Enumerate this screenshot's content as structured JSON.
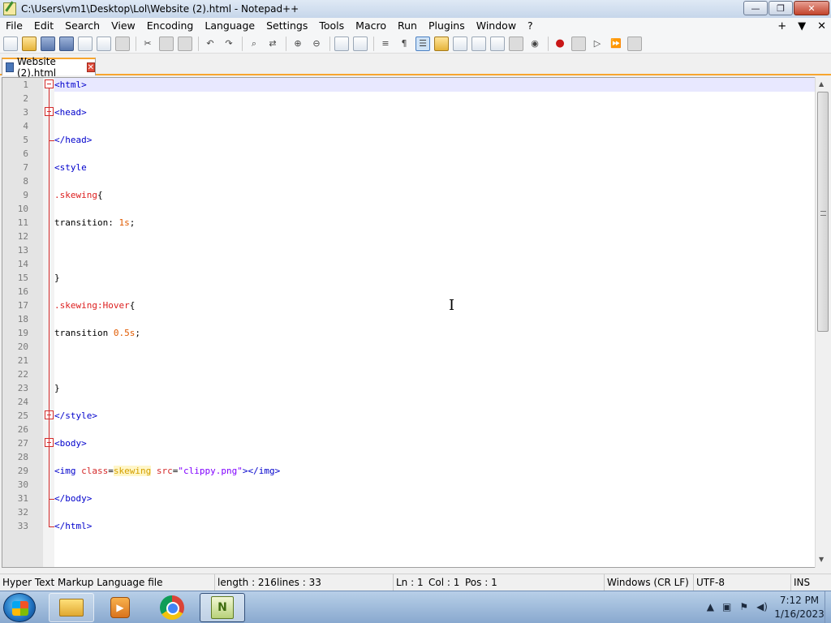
{
  "window": {
    "title": "C:\\Users\\vm1\\Desktop\\Lol\\Website (2).html - Notepad++",
    "controls": {
      "minimize": "—",
      "maximize": "❐",
      "close": "✕"
    }
  },
  "menu": {
    "items": [
      "File",
      "Edit",
      "Search",
      "View",
      "Encoding",
      "Language",
      "Settings",
      "Tools",
      "Macro",
      "Run",
      "Plugins",
      "Window",
      "?"
    ],
    "right": {
      "plus": "+",
      "down": "▼",
      "close": "✕"
    }
  },
  "toolbar": {
    "icons": [
      "new-file-icon",
      "open-file-icon",
      "save-icon",
      "save-all-icon",
      "close-icon",
      "close-all-icon",
      "print-icon",
      "cut-icon",
      "copy-icon",
      "paste-icon",
      "undo-icon",
      "redo-icon",
      "find-icon",
      "replace-icon",
      "zoom-in-icon",
      "zoom-out-icon",
      "sync-vertical-icon",
      "sync-horizontal-icon",
      "word-wrap-icon",
      "show-all-chars-icon",
      "indent-guide-icon",
      "language-icon",
      "document-map-icon",
      "function-list-icon",
      "folder-workspace-icon",
      "monitoring-icon",
      "record-macro-icon",
      "stop-macro-icon",
      "play-macro-icon",
      "run-macro-multiple-icon",
      "save-macro-icon"
    ]
  },
  "tab": {
    "label": "Website (2).html"
  },
  "editor": {
    "lines": [
      {
        "n": "1",
        "segments": [
          {
            "t": "<html>",
            "c": "tag"
          }
        ]
      },
      {
        "n": "2",
        "segments": []
      },
      {
        "n": "3",
        "segments": [
          {
            "t": "<head>",
            "c": "tag"
          }
        ]
      },
      {
        "n": "4",
        "segments": []
      },
      {
        "n": "5",
        "segments": [
          {
            "t": "</head>",
            "c": "tag"
          }
        ]
      },
      {
        "n": "6",
        "segments": []
      },
      {
        "n": "7",
        "segments": [
          {
            "t": "<style",
            "c": "tag"
          }
        ]
      },
      {
        "n": "8",
        "segments": []
      },
      {
        "n": "9",
        "segments": [
          {
            "t": ".skewing",
            "c": "sel"
          },
          {
            "t": "{",
            "c": "brace"
          }
        ]
      },
      {
        "n": "10",
        "segments": []
      },
      {
        "n": "11",
        "segments": [
          {
            "t": "transition: ",
            "c": "plain"
          },
          {
            "t": "1s",
            "c": "num"
          },
          {
            "t": ";",
            "c": "plain"
          }
        ]
      },
      {
        "n": "12",
        "segments": []
      },
      {
        "n": "13",
        "segments": []
      },
      {
        "n": "14",
        "segments": []
      },
      {
        "n": "15",
        "segments": [
          {
            "t": "}",
            "c": "brace"
          }
        ]
      },
      {
        "n": "16",
        "segments": []
      },
      {
        "n": "17",
        "segments": [
          {
            "t": ".skewing:Hover",
            "c": "sel"
          },
          {
            "t": "{",
            "c": "brace"
          }
        ]
      },
      {
        "n": "18",
        "segments": []
      },
      {
        "n": "19",
        "segments": [
          {
            "t": "transition ",
            "c": "plain"
          },
          {
            "t": "0.5s",
            "c": "num"
          },
          {
            "t": ";",
            "c": "plain"
          }
        ]
      },
      {
        "n": "20",
        "segments": []
      },
      {
        "n": "21",
        "segments": []
      },
      {
        "n": "22",
        "segments": []
      },
      {
        "n": "23",
        "segments": [
          {
            "t": "}",
            "c": "brace"
          }
        ]
      },
      {
        "n": "24",
        "segments": []
      },
      {
        "n": "25",
        "segments": [
          {
            "t": "</style>",
            "c": "tag"
          }
        ]
      },
      {
        "n": "26",
        "segments": []
      },
      {
        "n": "27",
        "segments": [
          {
            "t": "<body>",
            "c": "tag"
          }
        ]
      },
      {
        "n": "28",
        "segments": []
      },
      {
        "n": "29",
        "segments": [
          {
            "t": "<img ",
            "c": "tag"
          },
          {
            "t": "class",
            "c": "attr"
          },
          {
            "t": "=",
            "c": "plain"
          },
          {
            "t": "skewing",
            "c": "hl"
          },
          {
            "t": " ",
            "c": "plain"
          },
          {
            "t": "src",
            "c": "attr"
          },
          {
            "t": "=",
            "c": "plain"
          },
          {
            "t": "\"clippy.png\"",
            "c": "str"
          },
          {
            "t": "></img>",
            "c": "tag"
          }
        ]
      },
      {
        "n": "30",
        "segments": []
      },
      {
        "n": "31",
        "segments": [
          {
            "t": "</body>",
            "c": "tag"
          }
        ]
      },
      {
        "n": "32",
        "segments": []
      },
      {
        "n": "33",
        "segments": [
          {
            "t": "</html>",
            "c": "tag"
          }
        ]
      }
    ]
  },
  "status": {
    "file_type": "Hyper Text Markup Language file",
    "length": "length : 216",
    "lines": "lines : 33",
    "ln": "Ln : 1",
    "col": "Col : 1",
    "pos": "Pos : 1",
    "eol": "Windows (CR LF)",
    "encoding": "UTF-8",
    "mode": "INS"
  },
  "taskbar": {
    "npp_label": "N",
    "media_label": "▶",
    "tray_chevron": "▲",
    "time": "7:12 PM",
    "date": "1/16/2023"
  },
  "colors": {
    "accent": "#f7a52e",
    "tag": "#0000cc",
    "selector": "#dd2020",
    "number": "#e05a00",
    "string": "#8000ff"
  }
}
